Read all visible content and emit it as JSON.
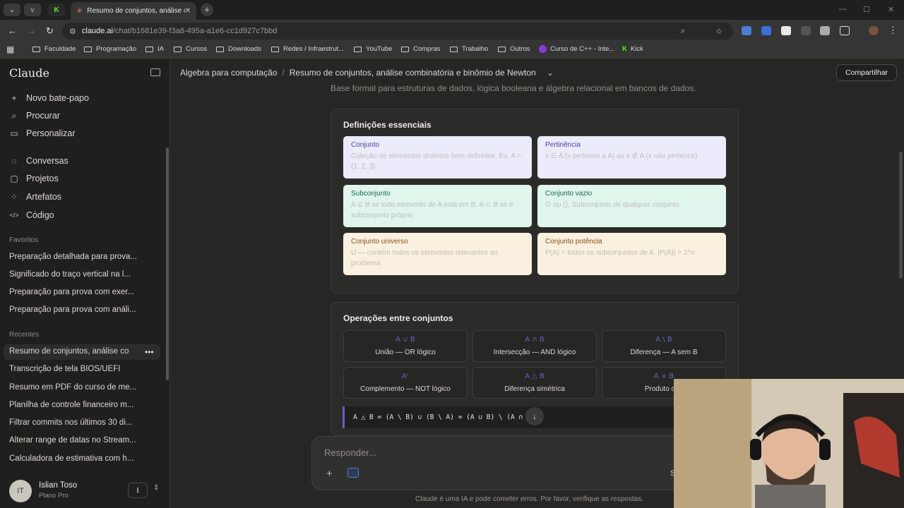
{
  "browser": {
    "tab_title": "Resumo de conjuntos, análise c",
    "url_host": "claude.ai",
    "url_path": "/chat/b1681e39-f3a8-495a-a1e6-cc1d927c7bbd",
    "bookmarks": [
      "Faculdade",
      "Programação",
      "IA",
      "Cursos",
      "Downloads",
      "Redes / Infraestrut...",
      "YouTube",
      "Compras",
      "Trabalho",
      "Outros",
      "Curso de C++ - Inte...",
      "Kick"
    ]
  },
  "sidebar": {
    "logo": "Claude",
    "nav": [
      {
        "icon": "plus-icon",
        "label": "Novo bate-papo"
      },
      {
        "icon": "search-icon",
        "label": "Procurar"
      },
      {
        "icon": "briefcase-icon",
        "label": "Personalizar"
      },
      {
        "icon": "chat-icon",
        "label": "Conversas"
      },
      {
        "icon": "folder-icon",
        "label": "Projetos"
      },
      {
        "icon": "artifacts-icon",
        "label": "Artefatos"
      },
      {
        "icon": "code-icon",
        "label": "Código"
      }
    ],
    "favorites_heading": "Favoritos",
    "favorites": [
      "Preparação detalhada para prova...",
      "Significado do traço vertical na l...",
      "Preparação para prova com exer...",
      "Preparação para prova com análi..."
    ],
    "recents_heading": "Recentes",
    "recents": [
      "Resumo de conjuntos, análise co",
      "Transcrição de tela BIOS/UEFI",
      "Resumo em PDF do curso de me...",
      "Planilha de controle financeiro m...",
      "Filtrar commits nos últimos 30 di...",
      "Alterar range de datas no Stream...",
      "Calculadora de estimativa com h..."
    ],
    "user": {
      "initials": "IT",
      "name": "Islian Toso",
      "plan": "Plano Pro"
    }
  },
  "header": {
    "project": "Algebra para computação",
    "separator": "/",
    "title": "Resumo de conjuntos, análise combinatória e binômio de Newton",
    "share_label": "Compartilhar"
  },
  "content": {
    "subtitle": "Base formal para estruturas de dados, lógica booleana e álgebra relacional em bancos de dados.",
    "definitions_title": "Definições essenciais",
    "definitions": [
      {
        "title": "Conjunto",
        "desc": "Coleção de elementos distintos bem definidos. Ex: A = {1, 2, 3}"
      },
      {
        "title": "Pertinência",
        "desc": "x ∈ A (x pertence a A) ou x ∉ A (x não pertence)"
      },
      {
        "title": "Subconjunto",
        "desc": "A ⊆ B se todo elemento de A está em B. A ⊂ B se é subconjunto próprio"
      },
      {
        "title": "Conjunto vazio",
        "desc": "∅ ou {}. Subconjunto de qualquer conjunto"
      },
      {
        "title": "Conjunto universo",
        "desc": "U — contém todos os elementos relevantes ao problema"
      },
      {
        "title": "Conjunto potência",
        "desc": "P(A) = todos os subconjuntos de A. |P(A)| = 2^n"
      }
    ],
    "operations_title": "Operações entre conjuntos",
    "operations": [
      {
        "symbol": "A ∪ B",
        "label": "União — OR lógico"
      },
      {
        "symbol": "A ∩ B",
        "label": "Intersecção — AND lógico"
      },
      {
        "symbol": "A \\ B",
        "label": "Diferença — A sem B"
      },
      {
        "symbol": "Aᶜ",
        "label": "Complemento — NOT lógico"
      },
      {
        "symbol": "A △ B",
        "label": "Diferença simétrica"
      },
      {
        "symbol": "A × B",
        "label": "Produto cart"
      }
    ],
    "formula": "A △ B = (A \\ B) ∪ (B \\ A) = (A ∪ B) \\ (A ∩ B)"
  },
  "composer": {
    "placeholder": "Responder...",
    "model_abbr": "S"
  },
  "disclaimer": "Claude é uma IA e pode cometer erros. Por favor, verifique as respostas."
}
